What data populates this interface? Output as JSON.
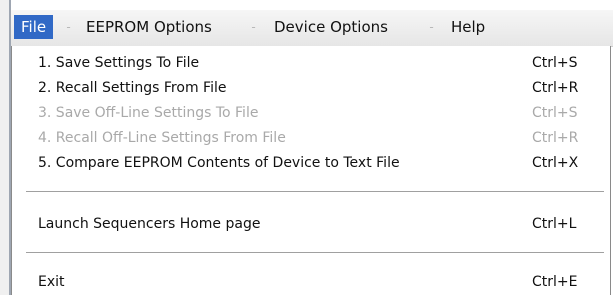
{
  "menubar": {
    "items": [
      {
        "label": "File"
      },
      {
        "label": "EEPROM Options"
      },
      {
        "label": "Device Options"
      },
      {
        "label": "Help"
      }
    ],
    "separator": "-"
  },
  "file_menu": {
    "items": [
      {
        "label": "1. Save Settings To File",
        "shortcut": "Ctrl+S",
        "enabled": true
      },
      {
        "label": "2. Recall Settings From File",
        "shortcut": "Ctrl+R",
        "enabled": true
      },
      {
        "label": "3. Save Off-Line Settings To File",
        "shortcut": "Ctrl+S",
        "enabled": false
      },
      {
        "label": "4. Recall Off-Line Settings From File",
        "shortcut": "Ctrl+R",
        "enabled": false
      },
      {
        "label": "5. Compare EEPROM Contents of Device to Text File",
        "shortcut": "Ctrl+X",
        "enabled": true
      },
      {
        "label": "Launch Sequencers Home page",
        "shortcut": "Ctrl+L",
        "enabled": true
      },
      {
        "label": "Exit",
        "shortcut": "Ctrl+E",
        "enabled": true
      }
    ]
  },
  "colors": {
    "active_menu_bg": "#3169c6",
    "disabled_text": "#a9a9a9"
  }
}
